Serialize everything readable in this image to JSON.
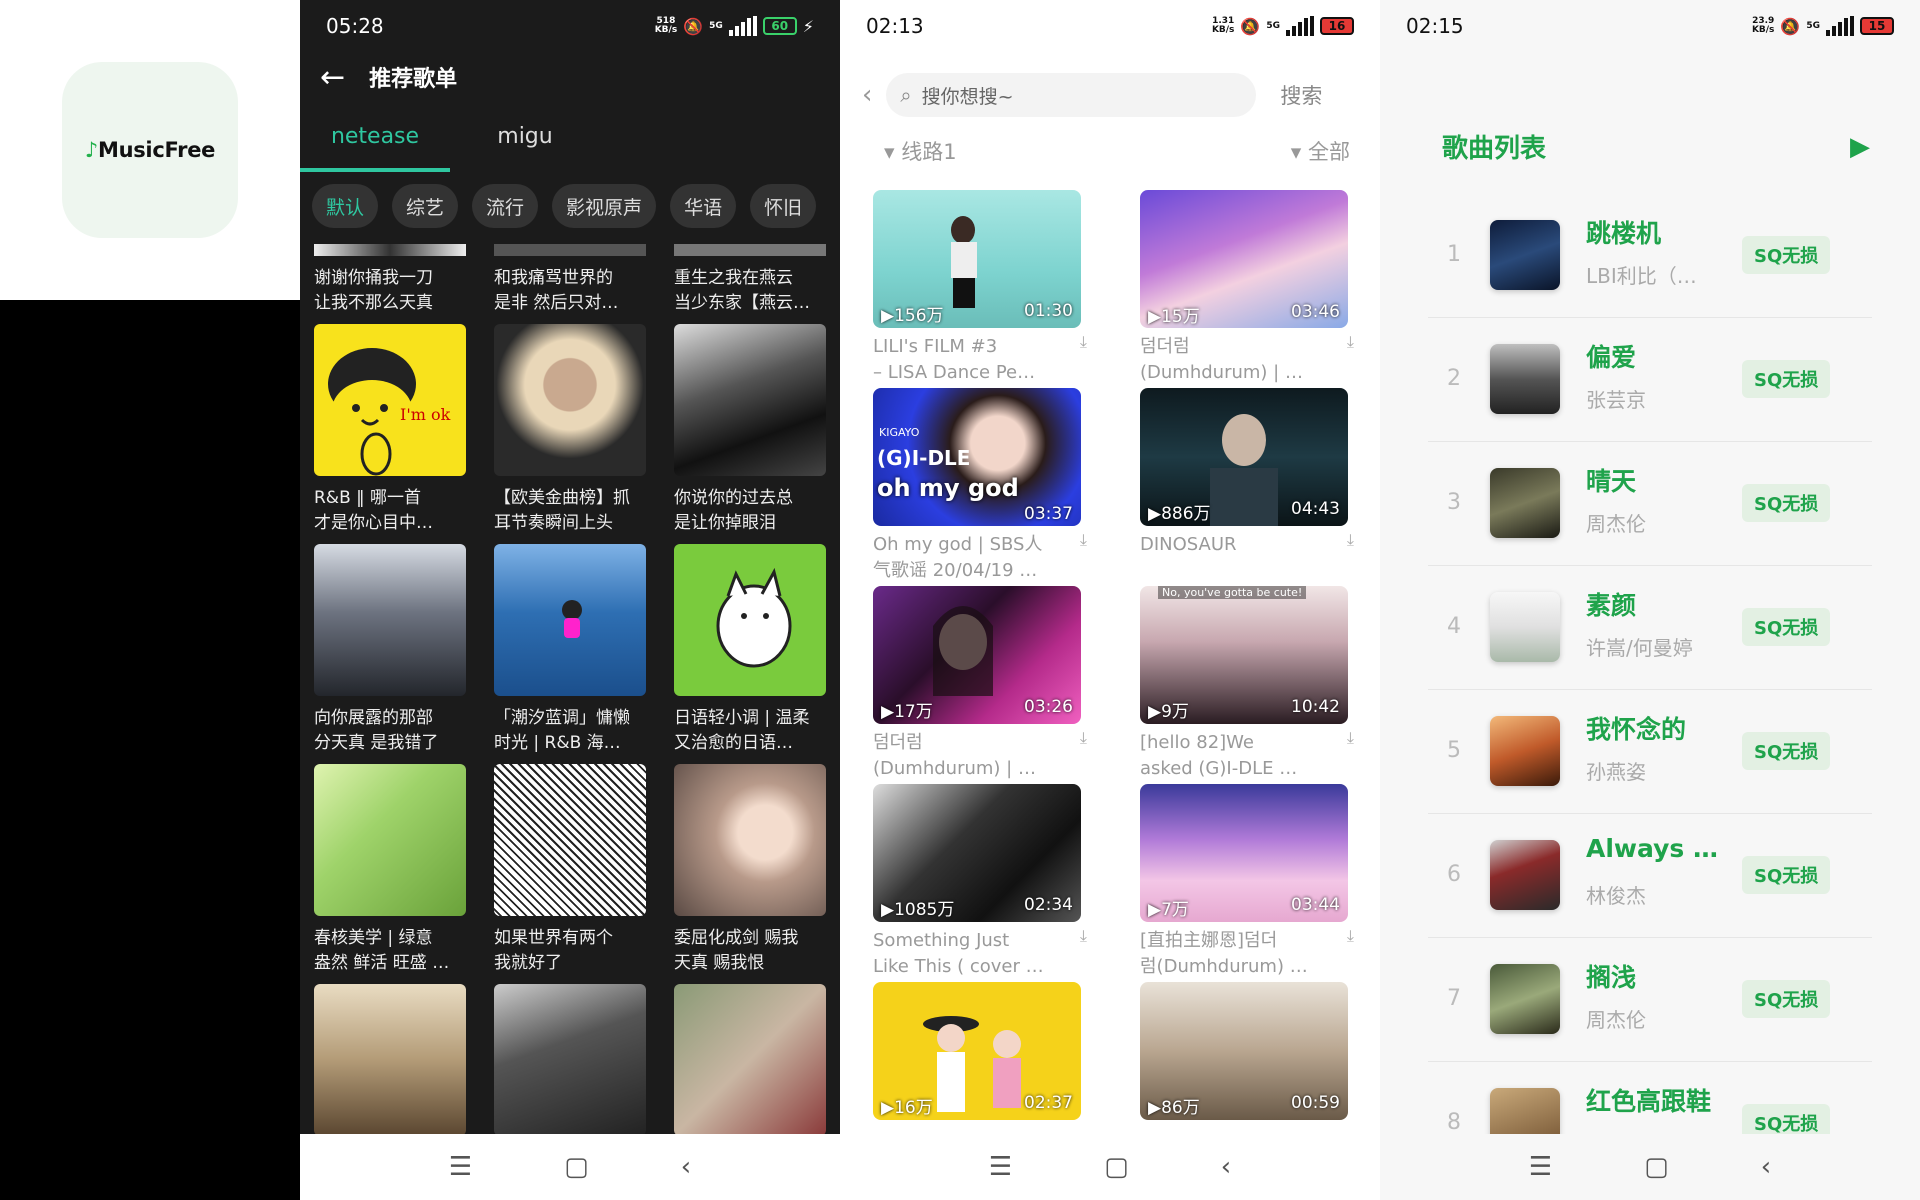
{
  "logo": {
    "text": "MusicFree"
  },
  "phone1": {
    "time": "05:28",
    "speed_value": "518",
    "speed_unit": "KB/s",
    "network": "5G",
    "battery": "60",
    "title": "推荐歌单",
    "tabs": [
      {
        "label": "netease",
        "active": true
      },
      {
        "label": "migu",
        "active": false
      }
    ],
    "chips": [
      {
        "label": "默认",
        "active": true
      },
      {
        "label": "综艺",
        "active": false
      },
      {
        "label": "流行",
        "active": false
      },
      {
        "label": "影视原声",
        "active": false
      },
      {
        "label": "华语",
        "active": false
      },
      {
        "label": "怀旧",
        "active": false
      }
    ],
    "top_row_captions": [
      [
        "谢谢你捅我一刀",
        "让我不那么天真"
      ],
      [
        "和我痛骂世界的",
        "是非 然后只对…"
      ],
      [
        "重生之我在燕云",
        "当少东家【燕云…"
      ]
    ],
    "rows": [
      [
        {
          "line1": "R&B ‖ 哪一首",
          "line2": "才是你心目中…"
        },
        {
          "line1": "【欧美金曲榜】抓",
          "line2": "耳节奏瞬间上头"
        },
        {
          "line1": "你说你的过去总",
          "line2": "是让你掉眼泪"
        }
      ],
      [
        {
          "line1": "向你展露的那部",
          "line2": "分天真 是我错了"
        },
        {
          "line1": "「潮汐蓝调」慵懒",
          "line2": "时光 | R&B 海…"
        },
        {
          "line1": "日语轻小调 | 温柔",
          "line2": "又治愈的日语…"
        }
      ],
      [
        {
          "line1": "春核美学 | 绿意",
          "line2": "盎然 鲜活 旺盛 …"
        },
        {
          "line1": "如果世界有两个",
          "line2": "我就好了"
        },
        {
          "line1": "委屈化成剑 赐我",
          "line2": "天真 赐我恨"
        }
      ]
    ],
    "cover_overlays": {
      "im_ok": "I'm ok"
    },
    "colors": {
      "accent": "#2fc7a0"
    }
  },
  "phone2": {
    "time": "02:13",
    "speed_value": "1.31",
    "speed_unit": "KB/s",
    "network": "5G",
    "battery": "16",
    "search_placeholder": "搜你想搜~",
    "search_button": "搜索",
    "filter_left": "线路1",
    "filter_right": "全部",
    "videos": [
      {
        "views": "156万",
        "duration": "01:30",
        "line1": "LILI's FILM #3",
        "line2": "– LISA Dance Pe…"
      },
      {
        "views": "15万",
        "duration": "03:46",
        "line1": "덤더럼",
        "line2": "(Dumhdurum) | …"
      },
      {
        "views": "",
        "duration": "03:37",
        "line1": "Oh my god | SBS人",
        "line2": "气歌谣 20/04/19 …"
      },
      {
        "views": "886万",
        "duration": "04:43",
        "line1": "DINOSAUR",
        "line2": ""
      },
      {
        "views": "17万",
        "duration": "03:26",
        "line1": "덤더럼",
        "line2": "(Dumhdurum) | …"
      },
      {
        "views": "9万",
        "duration": "10:42",
        "line1": "[hello 82]We",
        "line2": "asked (G)I-DLE …"
      },
      {
        "views": "1085万",
        "duration": "02:34",
        "line1": "Something Just",
        "line2": "Like This ( cover …"
      },
      {
        "views": "7万",
        "duration": "03:44",
        "line1": "[直拍主娜恩]덤더",
        "line2": "럼(Dumhdurum) …"
      },
      {
        "views": "16万",
        "duration": "02:37",
        "line1": "",
        "line2": ""
      },
      {
        "views": "86万",
        "duration": "00:59",
        "line1": "",
        "line2": ""
      }
    ],
    "thumb_overlays": {
      "gidle": "(G)I-DLE",
      "ohmygod": "oh my god",
      "cute": "No, you've gotta be cute!",
      "kigayo": "KIGAYO"
    }
  },
  "phone3": {
    "time": "02:15",
    "speed_value": "23.9",
    "speed_unit": "KB/s",
    "network": "5G",
    "battery": "15",
    "title": "歌曲列表",
    "songs": [
      {
        "index": "1",
        "name": "跳楼机",
        "artist": "LBI利比（…",
        "badge": "SQ无损"
      },
      {
        "index": "2",
        "name": "偏爱",
        "artist": "张芸京",
        "badge": "SQ无损"
      },
      {
        "index": "3",
        "name": "晴天",
        "artist": "周杰伦",
        "badge": "SQ无损"
      },
      {
        "index": "4",
        "name": "素颜",
        "artist": "许嵩/何曼婷",
        "badge": "SQ无损"
      },
      {
        "index": "5",
        "name": "我怀念的",
        "artist": "孙燕姿",
        "badge": "SQ无损"
      },
      {
        "index": "6",
        "name": "Always …",
        "artist": "林俊杰",
        "badge": "SQ无损"
      },
      {
        "index": "7",
        "name": "搁浅",
        "artist": "周杰伦",
        "badge": "SQ无损"
      },
      {
        "index": "8",
        "name": "红色高跟鞋",
        "artist": "",
        "badge": "SQ无损"
      }
    ],
    "colors": {
      "accent": "#1fa34b"
    }
  },
  "icons": {
    "back": "arrow-left-icon",
    "menu": "menu-icon",
    "home": "home-square-icon",
    "navback": "chevron-left-icon",
    "play": "play-icon",
    "search": "search-icon",
    "download": "download-icon",
    "filter": "triangle-down-icon"
  }
}
